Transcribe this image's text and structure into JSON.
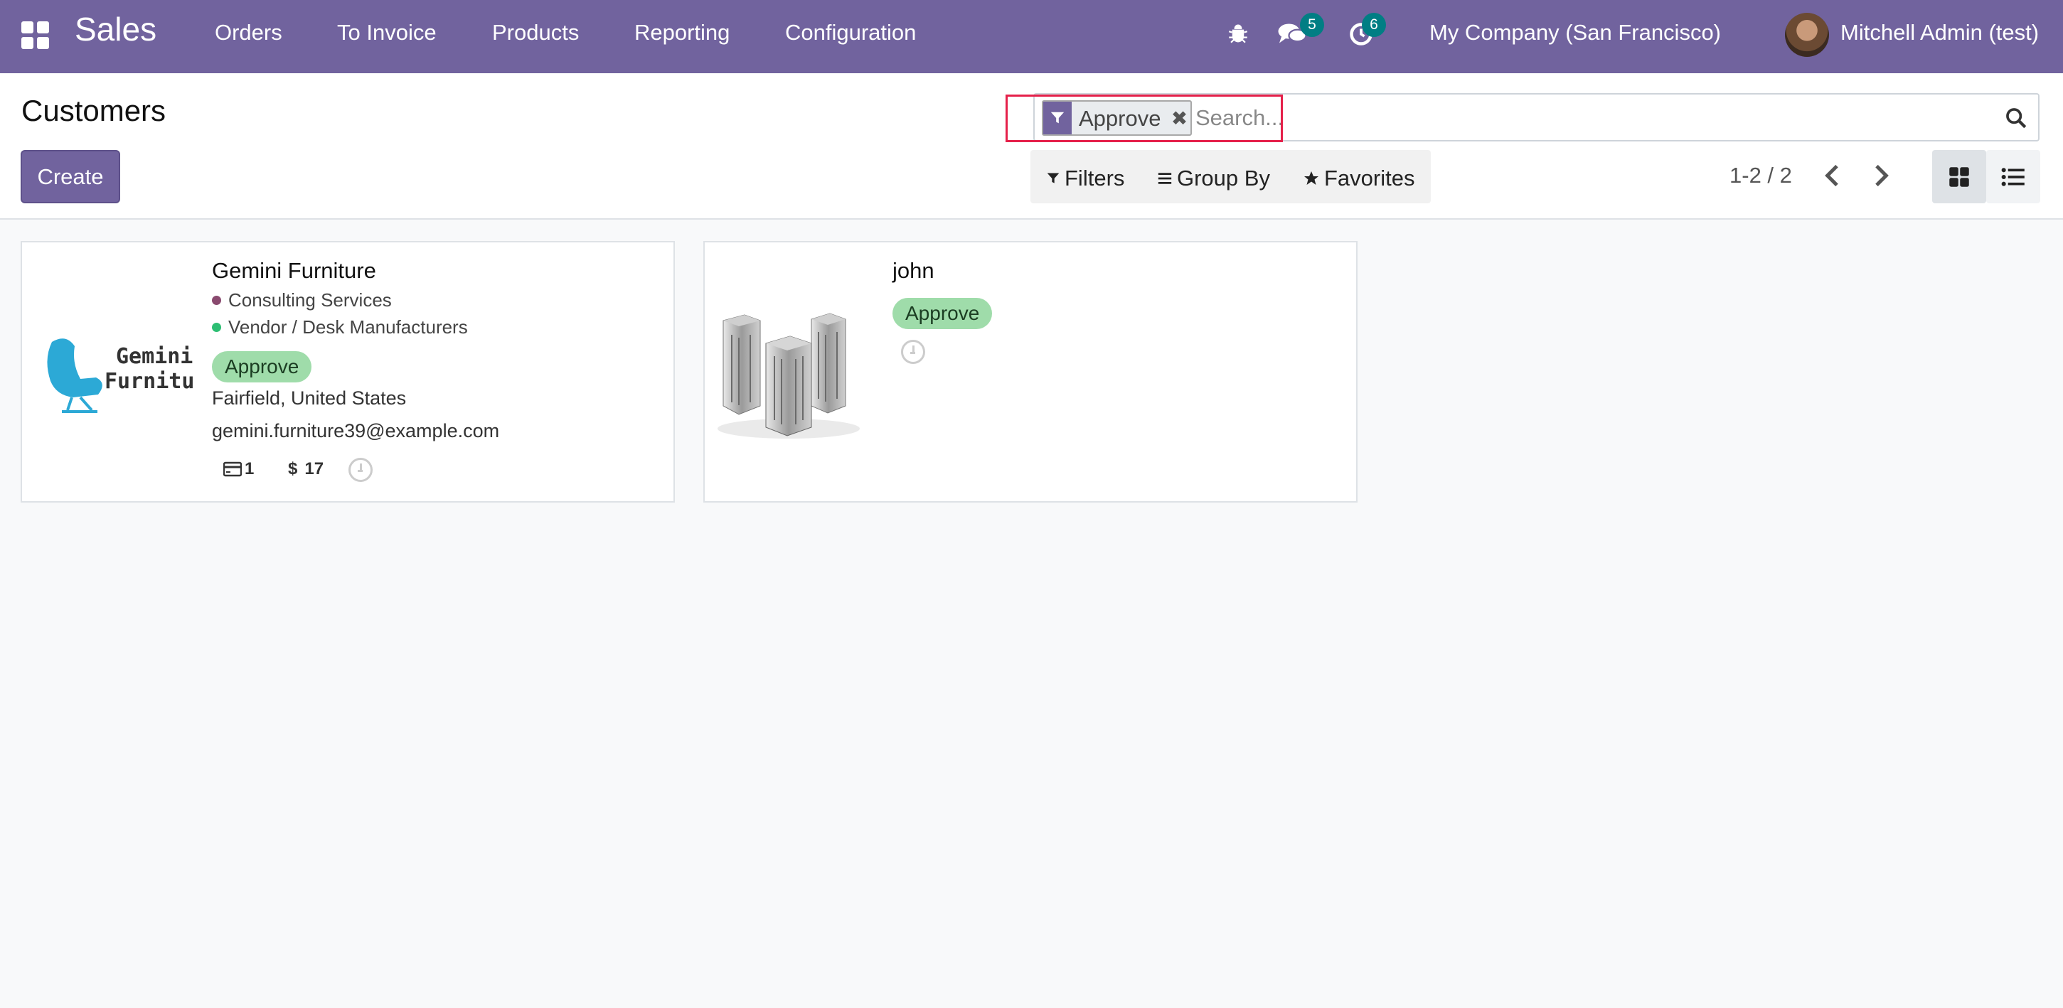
{
  "navbar": {
    "app_name": "Sales",
    "menu": [
      "Orders",
      "To Invoice",
      "Products",
      "Reporting",
      "Configuration"
    ],
    "messages_count": "5",
    "activities_count": "6",
    "company": "My Company (San Francisco)",
    "user": "Mitchell Admin (test)",
    "accent_color": "#71639e"
  },
  "control_panel": {
    "title": "Customers",
    "create_label": "Create",
    "search": {
      "facet_label": "Approve",
      "placeholder": "Search..."
    },
    "filters_label": "Filters",
    "groupby_label": "Group By",
    "favorites_label": "Favorites",
    "pager": "1-2 / 2"
  },
  "cards": [
    {
      "name": "Gemini Furniture",
      "logo_text_1": "Gemini",
      "logo_text_2": "Furniture",
      "tags": [
        {
          "label": "Consulting Services",
          "color": "#8a4a6f"
        },
        {
          "label": "Vendor / Desk Manufacturers",
          "color": "#2dbe73"
        }
      ],
      "badge": "Approve",
      "location": "Fairfield, United States",
      "email": "gemini.furniture39@example.com",
      "meetings": "1",
      "sales": "17"
    },
    {
      "name": "john",
      "badge": "Approve"
    }
  ]
}
